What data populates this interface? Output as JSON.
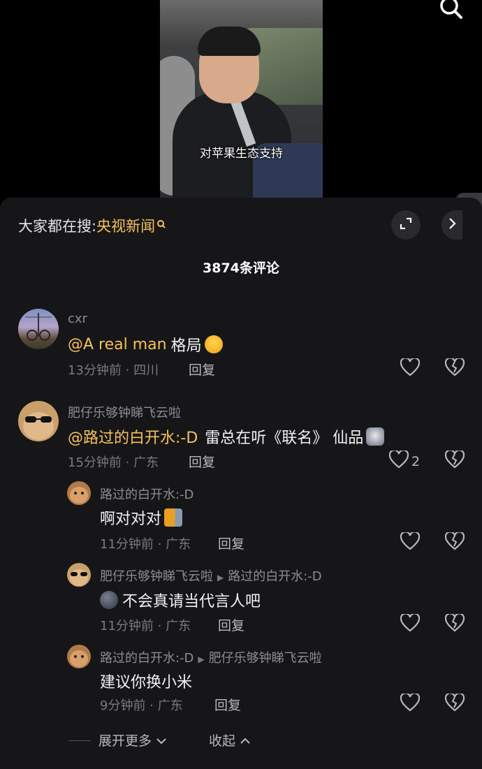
{
  "video": {
    "caption": "对苹果生态支持"
  },
  "hot_search": {
    "prefix": "大家都在搜:",
    "keyword": "央视新闻"
  },
  "comment_count": "3874条评论",
  "comments": [
    {
      "user": "cxr",
      "mention": "@A  real  man",
      "text": "格局",
      "time_loc": "13分钟前 · 四川",
      "reply": "回复",
      "likes": ""
    },
    {
      "user": "肥仔乐够钟睇飞云啦",
      "mention": "@路过的白开水:-D",
      "text": "雷总在听《联名》 仙品",
      "time_loc": "15分钟前 · 广东",
      "reply": "回复",
      "likes": "2"
    }
  ],
  "replies": [
    {
      "user": "路过的白开水:-D",
      "reply_to": "",
      "text": "啊对对对",
      "time_loc": "11分钟前 · 广东",
      "reply": "回复"
    },
    {
      "user": "肥仔乐够钟睇飞云啦",
      "reply_to": "路过的白开水:-D",
      "text": "不会真请当代言人吧",
      "time_loc": "11分钟前 · 广东",
      "reply": "回复"
    },
    {
      "user": "路过的白开水:-D",
      "reply_to": "肥仔乐够钟睇飞云啦",
      "text": "建议你换小米",
      "time_loc": "9分钟前 · 广东",
      "reply": "回复"
    }
  ],
  "footer": {
    "expand_more": "展开更多",
    "collapse": "收起"
  },
  "colors": {
    "accent": "#f5c15a",
    "sheet_bg": "#161618",
    "muted": "#7b7b7e"
  },
  "icons": [
    "search-icon",
    "expand-icon",
    "chevron-right-icon",
    "chevron-left-icon",
    "heart-icon",
    "broken-heart-icon",
    "chevron-down-icon",
    "chevron-up-icon"
  ]
}
